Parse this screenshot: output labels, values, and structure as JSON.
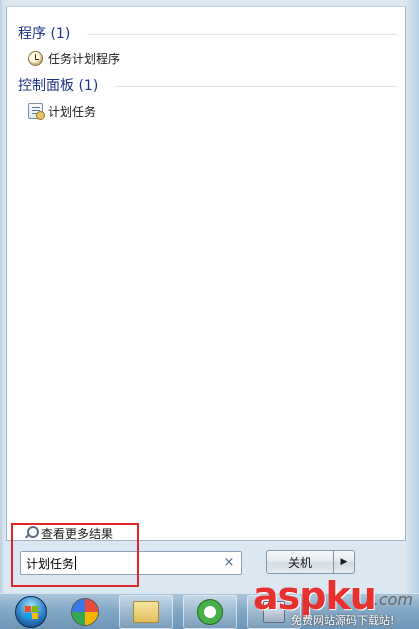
{
  "start_menu": {
    "groups": [
      {
        "header": "程序 (1)",
        "items": [
          {
            "label": "任务计划程序",
            "icon": "clock-icon"
          }
        ]
      },
      {
        "header": "控制面板 (1)",
        "items": [
          {
            "label": "计划任务",
            "icon": "task-scheduler-icon"
          }
        ]
      }
    ],
    "see_more": "查看更多结果",
    "search": {
      "value": "计划任务",
      "clear_icon": "×"
    },
    "shutdown": {
      "label": "关机",
      "arrow": "▶"
    }
  },
  "taskbar": {
    "buttons": [
      {
        "icon": "windows-orb-icon"
      },
      {
        "icon": "colorful-ball-icon"
      },
      {
        "icon": "folder-icon"
      },
      {
        "icon": "ie-icon"
      },
      {
        "icon": "app-icon"
      }
    ]
  },
  "watermark": {
    "logo": "aspku",
    "suffix": ".com",
    "subtitle": "免费网站源码下载站!"
  },
  "colors": {
    "group_header": "#1e3287",
    "highlight_box": "#e0262d",
    "watermark": "#e8302e"
  }
}
